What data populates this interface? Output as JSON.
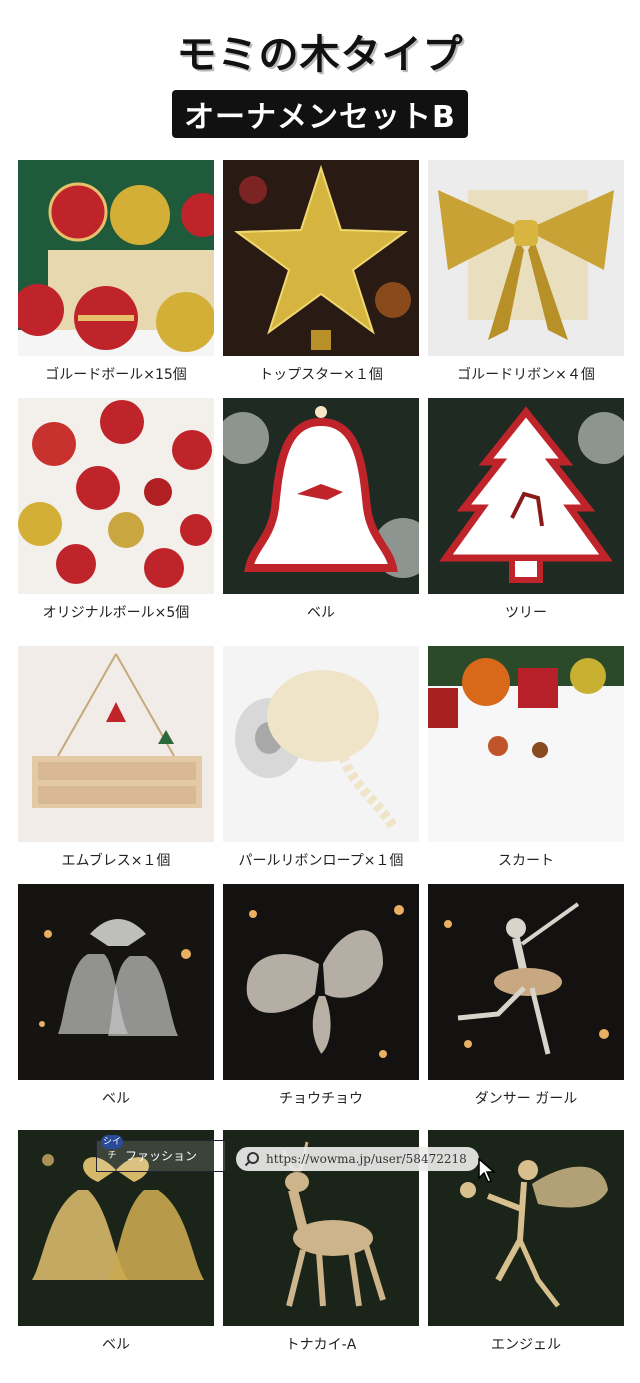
{
  "header": {
    "title": "モミの木タイプ",
    "subtitle": "オーナメンセットB"
  },
  "items": [
    {
      "caption": "ゴルードボール×15個",
      "icon": "ornament-balls"
    },
    {
      "caption": "トップスター×１個",
      "icon": "star"
    },
    {
      "caption": "ゴルードリボン×４個",
      "icon": "bow"
    },
    {
      "caption": "オリジナルボール×5個",
      "icon": "ornament-balls"
    },
    {
      "caption": "ベル",
      "icon": "bell-card"
    },
    {
      "caption": "ツリー",
      "icon": "tree-card"
    },
    {
      "caption": "エムブレス×１個",
      "icon": "merry-christmas-sign"
    },
    {
      "caption": "パールリボンロープ×１個",
      "icon": "pearl-rope"
    },
    {
      "caption": "スカート",
      "icon": "tree-skirt"
    },
    {
      "caption": "ベル",
      "icon": "glass-bells"
    },
    {
      "caption": "チョウチョウ",
      "icon": "butterfly"
    },
    {
      "caption": "ダンサー ガール",
      "icon": "dancer"
    },
    {
      "caption": "ベル",
      "icon": "gold-bell"
    },
    {
      "caption": "トナカイ-A",
      "icon": "reindeer"
    },
    {
      "caption": "エンジェル",
      "icon": "angel"
    }
  ],
  "watermark": {
    "logo_text": "ファッション",
    "logo_badge": "シイチ",
    "url": "https://wowma.jp/user/58472218"
  },
  "colors": {
    "red": "#c0242b",
    "gold": "#d4af37",
    "dark": "#111111"
  }
}
